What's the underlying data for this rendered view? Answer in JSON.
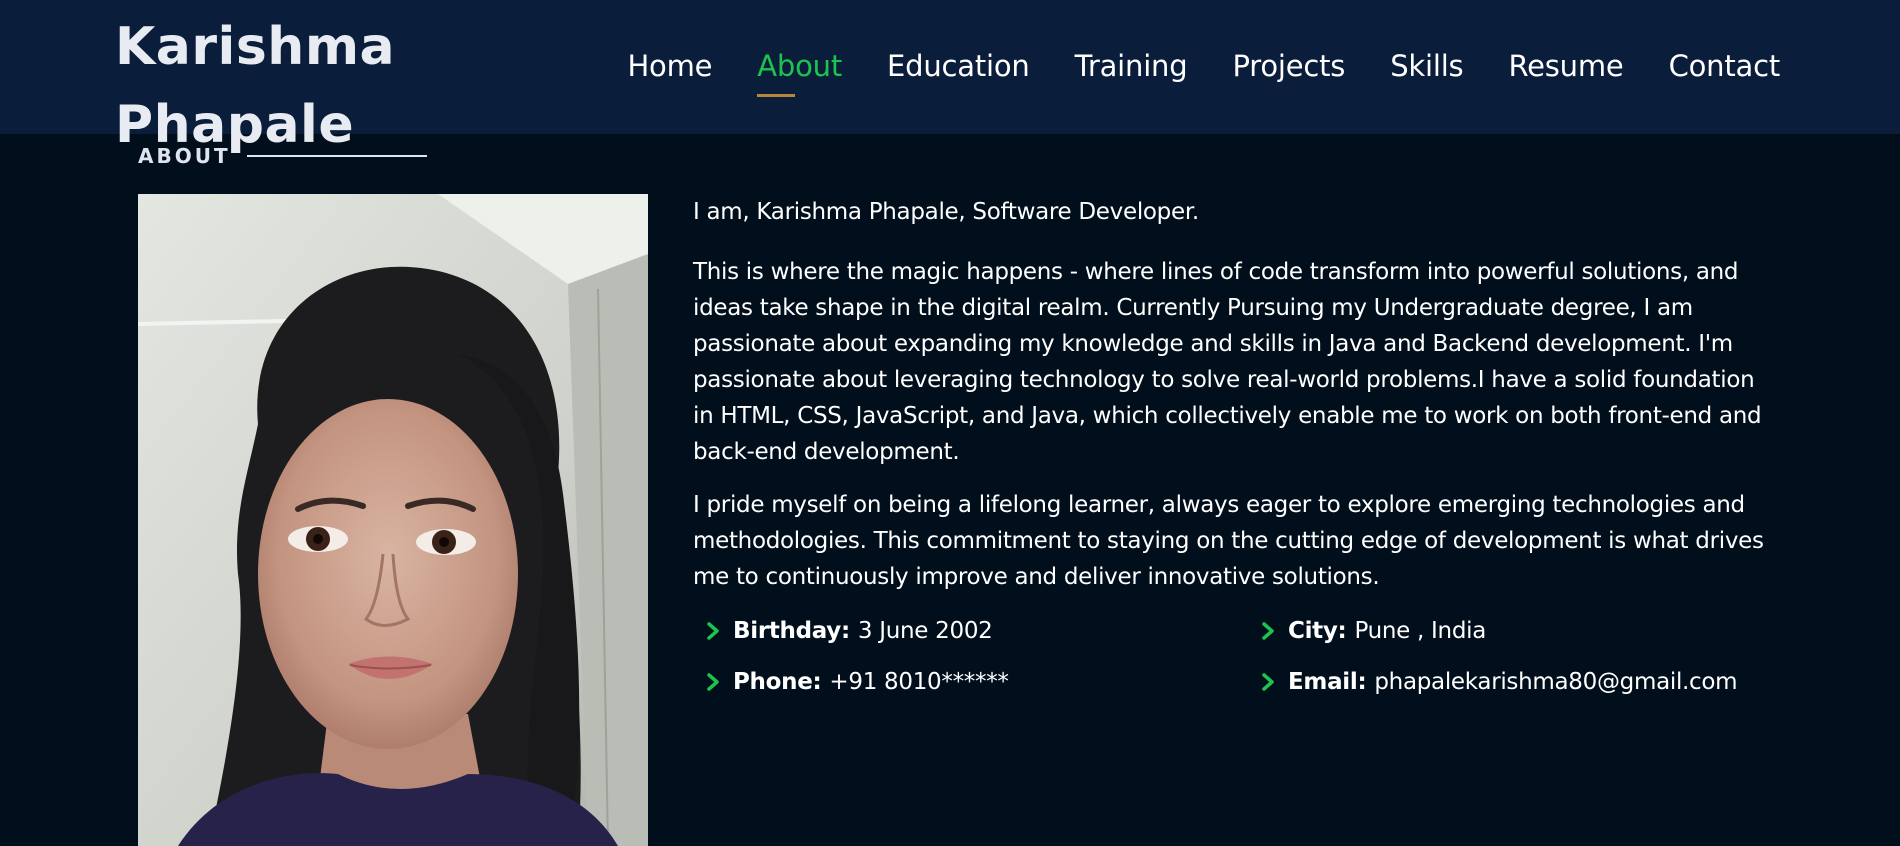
{
  "brand": {
    "line1": "Karishma",
    "line2": "Phapale"
  },
  "nav": {
    "items": [
      "Home",
      "About",
      "Education",
      "Training",
      "Projects",
      "Skills",
      "Resume",
      "Contact"
    ],
    "active": "About"
  },
  "section": {
    "label": "ABOUT"
  },
  "about": {
    "intro": "I am, Karishma Phapale, Software Developer.",
    "para1": "This is where the magic happens - where lines of code transform into powerful solutions, and ideas take shape in the digital realm. Currently Pursuing my Undergraduate degree, I am passionate about expanding my knowledge and skills in Java and Backend development. I'm passionate about leveraging technology to solve real-world problems.I have a solid foundation in HTML, CSS, JavaScript, and Java, which collectively enable me to work on both front-end and back-end development.",
    "para2": "I pride myself on being a lifelong learner, always eager to explore emerging technologies and methodologies. This commitment to staying on the cutting edge of development is what drives me to continuously improve and deliver innovative solutions."
  },
  "info": {
    "birthday_label": "Birthday:",
    "birthday_value": "3 June 2002",
    "city_label": "City:",
    "city_value": "Pune , India",
    "phone_label": "Phone:",
    "phone_value": "+91 8010******",
    "email_label": "Email:",
    "email_value": "phapalekarishma80@gmail.com"
  },
  "icons": {
    "list_bullet": "chevron-right-icon"
  },
  "colors": {
    "header_bg": "#0a1d3a",
    "page_bg": "#010e1b",
    "accent_green": "#1dc34e",
    "underline_gold": "#b8863b"
  }
}
